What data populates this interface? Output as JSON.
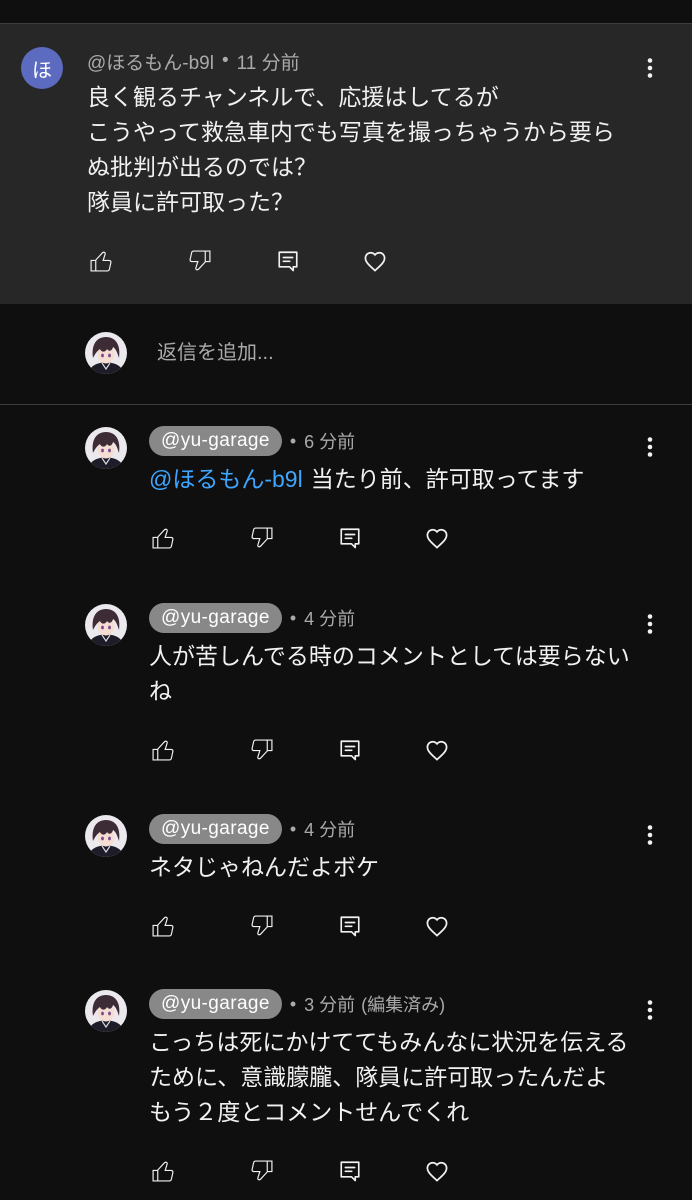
{
  "separator": "•",
  "comment": {
    "avatar_letter": "ほ",
    "author": "@ほるもん-b9l",
    "time": "11 分前",
    "lines": [
      "良く観るチャンネルで、応援はしてるが",
      "こうやって救急車内でも写真を撮っちゃうから要ら",
      "ぬ批判が出るのでは？",
      "隊員に許可取った？"
    ]
  },
  "reply_box": {
    "placeholder": "返信を追加..."
  },
  "replies": [
    {
      "author": "@yu-garage",
      "time": "6 分前",
      "mention": "@ほるもん-b9l",
      "lines": [
        "当たり前、許可取ってます"
      ]
    },
    {
      "author": "@yu-garage",
      "time": "4 分前",
      "lines": [
        "人が苦しんでる時のコメントとしては要らない",
        "ね"
      ]
    },
    {
      "author": "@yu-garage",
      "time": "4 分前",
      "lines": [
        "ネタじゃねんだよボケ"
      ]
    },
    {
      "author": "@yu-garage",
      "time": "3 分前",
      "edited_label": "(編集済み)",
      "lines": [
        "こっちは死にかけててもみんなに状況を伝える",
        "ために、意識朦朧、隊員に許可取ったんだよ",
        "もう２度とコメントせんでくれ"
      ]
    }
  ],
  "icons": {
    "menu": "more-vertical-icon",
    "like": "thumb-up-icon",
    "dislike": "thumb-down-icon",
    "reply": "reply-icon",
    "heart": "heart-icon"
  },
  "colors": {
    "background": "#0f0f0f",
    "comment_highlight": "#272727",
    "text_primary": "#f1f1f1",
    "text_secondary": "#aaaaaa",
    "mention": "#3ea6ff",
    "author_badge": "#888888",
    "avatar_letter_bg": "#5c6bc0",
    "divider": "#3d3d3d"
  }
}
